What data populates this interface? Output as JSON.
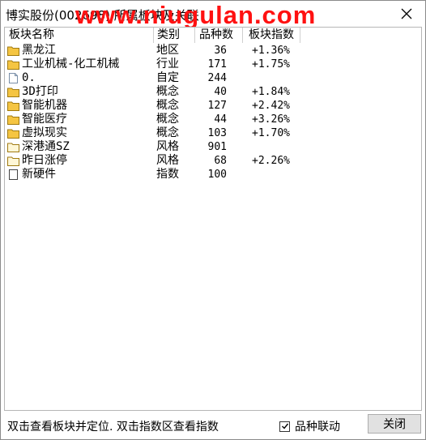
{
  "window": {
    "title": "博实股份(002698) 所属板块及关联"
  },
  "watermark": "www.niugulan.com",
  "columns": {
    "name": "板块名称",
    "type": "类别",
    "count": "品种数",
    "index": "板块指数"
  },
  "rows": [
    {
      "icon": "folder",
      "name": "黑龙江",
      "type": "地区",
      "count": "36",
      "index": "+1.36%"
    },
    {
      "icon": "folder",
      "name": "工业机械-化工机械",
      "type": "行业",
      "count": "171",
      "index": "+1.75%"
    },
    {
      "icon": "document",
      "name": "0.",
      "type": "自定",
      "count": "244",
      "index": ""
    },
    {
      "icon": "folder",
      "name": "3D打印",
      "type": "概念",
      "count": "40",
      "index": "+1.84%"
    },
    {
      "icon": "folder",
      "name": "智能机器",
      "type": "概念",
      "count": "127",
      "index": "+2.42%"
    },
    {
      "icon": "folder",
      "name": "智能医疗",
      "type": "概念",
      "count": "44",
      "index": "+3.26%"
    },
    {
      "icon": "folder",
      "name": "虚拟现实",
      "type": "概念",
      "count": "103",
      "index": "+1.70%"
    },
    {
      "icon": "folder-outline",
      "name": "深港通SZ",
      "type": "风格",
      "count": "901",
      "index": ""
    },
    {
      "icon": "folder-outline",
      "name": "昨日涨停",
      "type": "风格",
      "count": "68",
      "index": "+2.26%"
    },
    {
      "icon": "blank-doc",
      "name": "新硬件",
      "type": "指数",
      "count": "100",
      "index": ""
    }
  ],
  "status": {
    "hint": "双击查看板块并定位. 双击指数区查看指数",
    "link_label": "品种联动",
    "link_checked": true,
    "close_label": "关闭"
  },
  "colors": {
    "folder_fill": "#f5c542",
    "watermark": "#ff1111"
  }
}
